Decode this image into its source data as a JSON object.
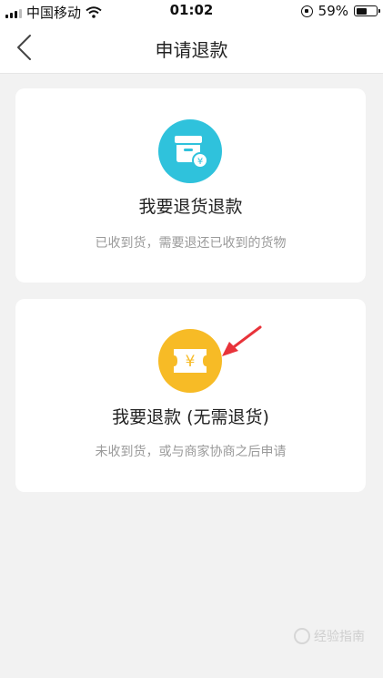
{
  "status_bar": {
    "carrier": "中国移动",
    "time": "01:02",
    "battery_percent": "59%",
    "battery_level": 0.59
  },
  "nav": {
    "title": "申请退款"
  },
  "options": [
    {
      "title": "我要退货退款",
      "description": "已收到货，需要退还已收到的货物",
      "icon": "return-box-icon",
      "icon_color": "#2fc2dc"
    },
    {
      "title": "我要退款 (无需退货)",
      "description": "未收到货，或与商家协商之后申请",
      "icon": "ticket-yen-icon",
      "icon_color": "#f7bb26"
    }
  ],
  "annotation_color": "#e8333a",
  "watermark": "经验指南"
}
